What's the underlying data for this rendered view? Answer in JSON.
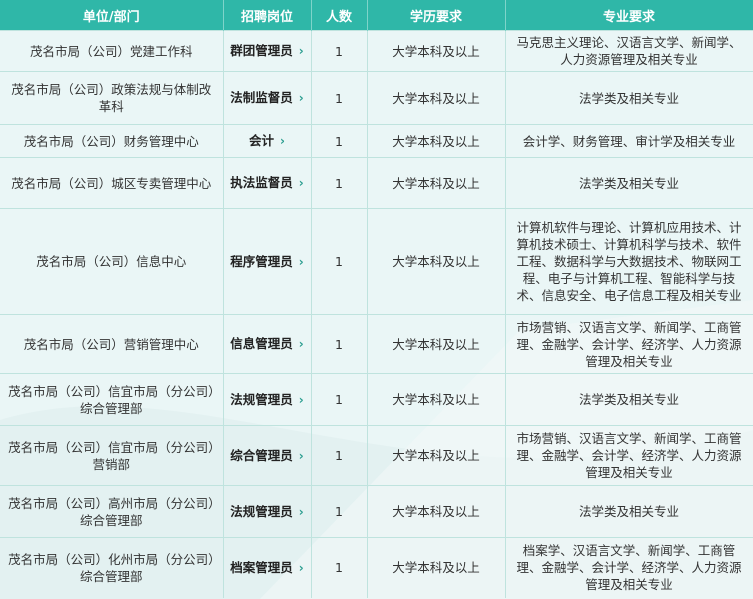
{
  "headers": [
    "单位/部门",
    "招聘岗位",
    "人数",
    "学历要求",
    "专业要求"
  ],
  "rows": [
    {
      "unit": "茂名市局（公司）党建工作科",
      "post": "群团管理员",
      "count": "1",
      "edu": "大学本科及以上",
      "major": "马克思主义理论、汉语言文学、新闻学、人力资源管理及相关专业"
    },
    {
      "unit": "茂名市局（公司）政策法规与体制改革科",
      "post": "法制监督员",
      "count": "1",
      "edu": "大学本科及以上",
      "major": "法学类及相关专业"
    },
    {
      "unit": "茂名市局（公司）财务管理中心",
      "post": "会计",
      "count": "1",
      "edu": "大学本科及以上",
      "major": "会计学、财务管理、审计学及相关专业"
    },
    {
      "unit": "茂名市局（公司）城区专卖管理中心",
      "post": "执法监督员",
      "count": "1",
      "edu": "大学本科及以上",
      "major": "法学类及相关专业"
    },
    {
      "unit": "茂名市局（公司）信息中心",
      "post": "程序管理员",
      "count": "1",
      "edu": "大学本科及以上",
      "major": "计算机软件与理论、计算机应用技术、计算机技术硕士、计算机科学与技术、软件工程、数据科学与大数据技术、物联网工程、电子与计算机工程、智能科学与技术、信息安全、电子信息工程及相关专业"
    },
    {
      "unit": "茂名市局（公司）营销管理中心",
      "post": "信息管理员",
      "count": "1",
      "edu": "大学本科及以上",
      "major": "市场营销、汉语言文学、新闻学、工商管理、金融学、会计学、经济学、人力资源管理及相关专业"
    },
    {
      "unit": "茂名市局（公司）信宜市局（分公司）综合管理部",
      "post": "法规管理员",
      "count": "1",
      "edu": "大学本科及以上",
      "major": "法学类及相关专业"
    },
    {
      "unit": "茂名市局（公司）信宜市局（分公司）营销部",
      "post": "综合管理员",
      "count": "1",
      "edu": "大学本科及以上",
      "major": "市场营销、汉语言文学、新闻学、工商管理、金融学、会计学、经济学、人力资源管理及相关专业"
    },
    {
      "unit": "茂名市局（公司）高州市局（分公司）综合管理部",
      "post": "法规管理员",
      "count": "1",
      "edu": "大学本科及以上",
      "major": "法学类及相关专业"
    },
    {
      "unit": "茂名市局（公司）化州市局（分公司）综合管理部",
      "post": "档案管理员",
      "count": "1",
      "edu": "大学本科及以上",
      "major": "档案学、汉语言文学、新闻学、工商管理、金融学、会计学、经济学、人力资源管理及相关专业"
    }
  ],
  "colors": {
    "header_bg": "#2fb7a8",
    "accent": "#2a9d8f"
  },
  "icons": {
    "post_marker": "chevron-right-icon"
  }
}
